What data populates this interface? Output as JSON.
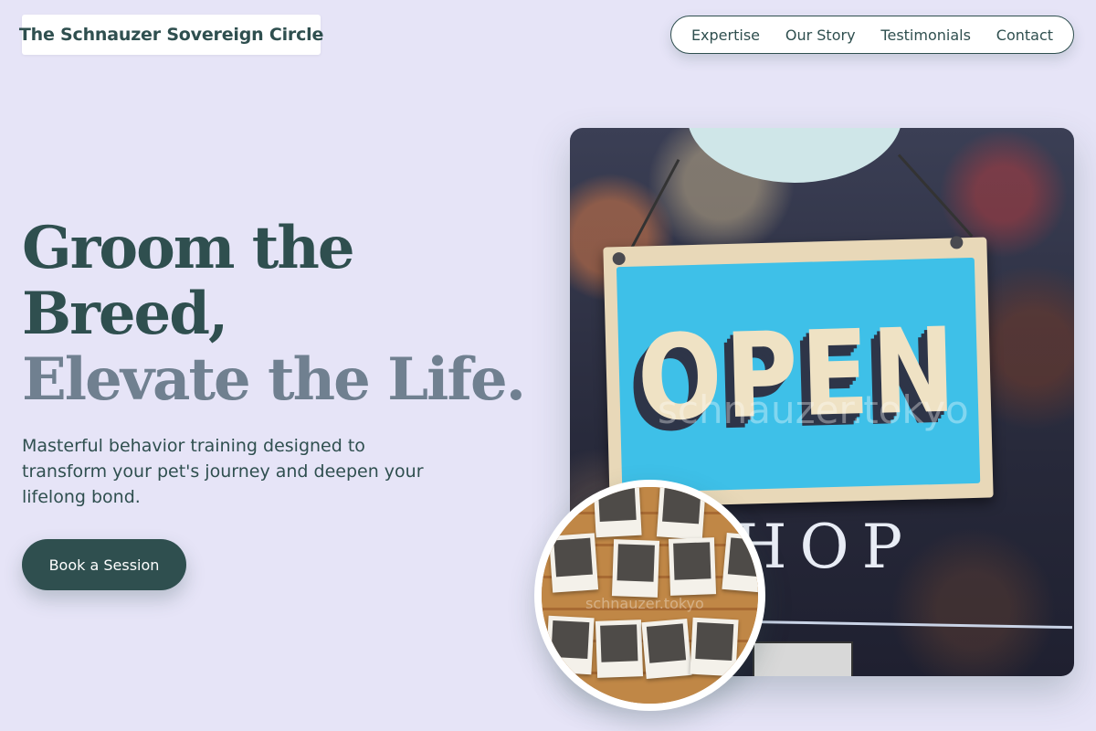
{
  "header": {
    "brand": "The Schnauzer Sovereign Circle",
    "nav": [
      {
        "label": "Expertise"
      },
      {
        "label": "Our Story"
      },
      {
        "label": "Testimonials"
      },
      {
        "label": "Contact"
      }
    ]
  },
  "hero": {
    "headline_line1": "Groom the",
    "headline_line2": "Breed,",
    "headline_accent": "Elevate the Life.",
    "subtitle": "Masterful behavior training designed to transform your pet's journey and deepen your lifelong bond.",
    "cta_label": "Book a Session"
  },
  "images": {
    "main_sign_text": "OPEN",
    "main_shop_text": "HOP",
    "watermark": "schnauzer.tokyo",
    "inset_watermark": "schnauzer.tokyo"
  },
  "colors": {
    "background": "#e6e4f7",
    "primary": "#2f4f4f",
    "accent": "#708090",
    "nav_background": "#ffffff"
  }
}
